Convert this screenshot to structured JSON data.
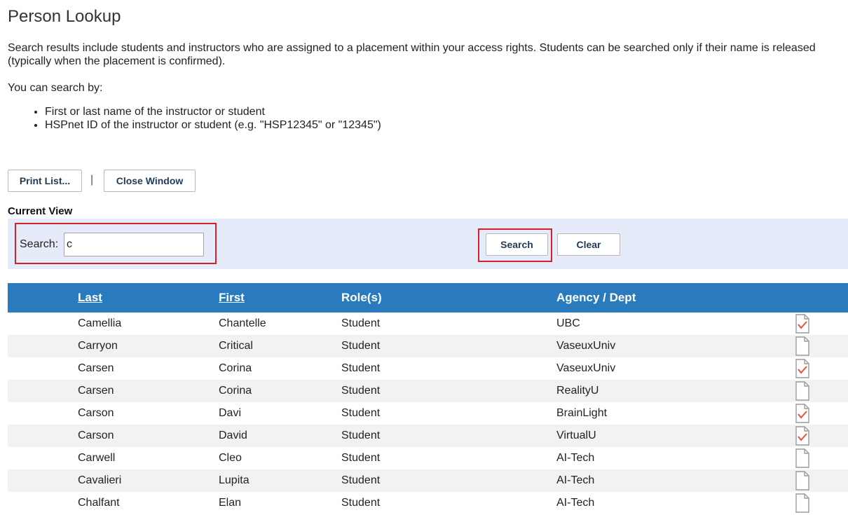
{
  "page": {
    "title": "Person Lookup",
    "description": "Search results include students and instructors who are assigned to a placement within your access rights. Students can be searched only if their name is released (typically when the placement is confirmed).",
    "search_by_intro": "You can search by:",
    "search_by_items": [
      "First or last name of the instructor or student",
      "HSPnet ID of the instructor or student (e.g. \"HSP12345\" or \"12345\")"
    ]
  },
  "toolbar": {
    "print_label": "Print List...",
    "separator": "|",
    "close_label": "Close Window"
  },
  "current_view": {
    "heading": "Current View",
    "search_label": "Search:",
    "search_value": "c",
    "search_button": "Search",
    "clear_button": "Clear"
  },
  "table": {
    "headers": {
      "last": "Last",
      "first": "First",
      "roles": "Role(s)",
      "agency": "Agency / Dept"
    },
    "rows": [
      {
        "last": "Camellia",
        "first": "Chantelle",
        "role": "Student",
        "agency": "UBC",
        "checked": true
      },
      {
        "last": "Carryon",
        "first": "Critical",
        "role": "Student",
        "agency": "VaseuxUniv",
        "checked": false
      },
      {
        "last": "Carsen",
        "first": "Corina",
        "role": "Student",
        "agency": "VaseuxUniv",
        "checked": true
      },
      {
        "last": "Carsen",
        "first": "Corina",
        "role": "Student",
        "agency": "RealityU",
        "checked": false
      },
      {
        "last": "Carson",
        "first": "Davi",
        "role": "Student",
        "agency": "BrainLight",
        "checked": true
      },
      {
        "last": "Carson",
        "first": "David",
        "role": "Student",
        "agency": "VirtualU",
        "checked": true
      },
      {
        "last": "Carwell",
        "first": "Cleo",
        "role": "Student",
        "agency": "AI-Tech",
        "checked": false
      },
      {
        "last": "Cavalieri",
        "first": "Lupita",
        "role": "Student",
        "agency": "AI-Tech",
        "checked": false
      },
      {
        "last": "Chalfant",
        "first": "Elan",
        "role": "Student",
        "agency": "AI-Tech",
        "checked": false
      }
    ]
  },
  "icons": {
    "row_icon_checked": "document-check-icon",
    "row_icon_plain": "document-icon"
  },
  "colors": {
    "header_bg": "#2a7bbd",
    "panel_bg": "#e6ebf9",
    "highlight": "#d6202e",
    "check": "#e0533a"
  }
}
